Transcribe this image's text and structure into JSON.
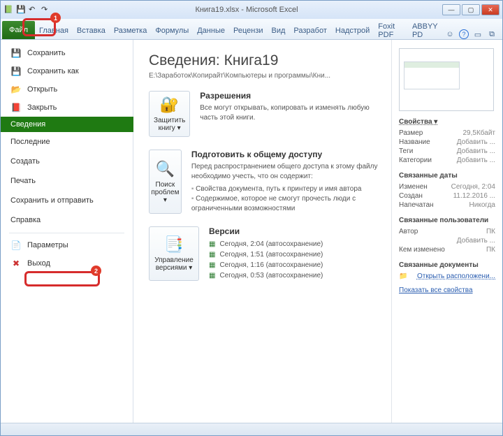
{
  "window": {
    "title": "Книга19.xlsx - Microsoft Excel"
  },
  "ribbon": {
    "file": "Файл",
    "tabs": [
      "Главная",
      "Вставка",
      "Разметка",
      "Формулы",
      "Данные",
      "Рецензи",
      "Вид",
      "Разработ",
      "Надстрой",
      "Foxit PDF",
      "ABBYY PD"
    ]
  },
  "sidebar": {
    "top": [
      {
        "icon": "💾",
        "label": "Сохранить"
      },
      {
        "icon": "💾",
        "label": "Сохранить как"
      },
      {
        "icon": "📂",
        "label": "Открыть"
      },
      {
        "icon": "📕",
        "label": "Закрыть"
      }
    ],
    "mid": [
      {
        "label": "Сведения",
        "selected": true
      },
      {
        "label": "Последние"
      },
      {
        "label": "Создать"
      },
      {
        "label": "Печать"
      },
      {
        "label": "Сохранить и отправить"
      },
      {
        "label": "Справка"
      }
    ],
    "bottom": [
      {
        "icon": "⚙",
        "label": "Параметры"
      },
      {
        "icon": "✖",
        "label": "Выход"
      }
    ]
  },
  "info": {
    "heading": "Сведения: Книга19",
    "path": "E:\\Заработок\\Копирайт\\Компьютеры и программы\\Кни...",
    "protect": {
      "btn": "Защитить книгу ▾",
      "title": "Разрешения",
      "text": "Все могут открывать, копировать и изменять любую часть этой книги."
    },
    "check": {
      "btn": "Поиск проблем ▾",
      "title": "Подготовить к общему доступу",
      "text": "Перед распространением общего доступа к этому файлу необходимо учесть, что он содержит:",
      "items": [
        "Свойства документа, путь к принтеру и имя автора",
        "Содержимое, которое не смогут прочесть люди с ограниченными возможностями"
      ]
    },
    "versions": {
      "btn": "Управление версиями ▾",
      "title": "Версии",
      "items": [
        "Сегодня, 2:04 (автосохранение)",
        "Сегодня, 1:51 (автосохранение)",
        "Сегодня, 1:16 (автосохранение)",
        "Сегодня, 0:53 (автосохранение)"
      ]
    }
  },
  "props": {
    "h": "Свойства ▾",
    "size_l": "Размер",
    "size_v": "29,5Кбайт",
    "name_l": "Название",
    "name_v": "Добавить ...",
    "tags_l": "Теги",
    "tags_v": "Добавить ...",
    "cat_l": "Категории",
    "cat_v": "Добавить ...",
    "dates_h": "Связанные даты",
    "mod_l": "Изменен",
    "mod_v": "Сегодня, 2:04",
    "cre_l": "Создан",
    "cre_v": "11.12.2016 ...",
    "prn_l": "Напечатан",
    "prn_v": "Никогда",
    "people_h": "Связанные пользователи",
    "auth_l": "Автор",
    "auth_v": "ПК",
    "add_auth": "Добавить ...",
    "chg_l": "Кем изменено",
    "chg_v": "ПК",
    "docs_h": "Связанные документы",
    "open_loc": "Открыть расположени...",
    "show_all": "Показать все свойства"
  },
  "callouts": {
    "b1": "1",
    "b2": "2"
  }
}
